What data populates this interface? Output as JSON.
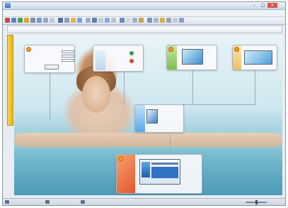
{
  "colors": {
    "accent": "#f0a020",
    "side_tab": "#f2c630",
    "canvas_water": "#78bccd",
    "node_orange": "#ef7a3a",
    "node_green": "#7fbf4a",
    "node_blue": "#5aa8e8"
  },
  "icons": [
    "app-icon",
    "minimize-icon",
    "maximize-icon",
    "close-icon",
    "toolbar-icons",
    "node-badge-icon",
    "check-icon",
    "cross-icon",
    "photo-thumbnail",
    "statusbar-icon",
    "zoom-slider"
  ]
}
